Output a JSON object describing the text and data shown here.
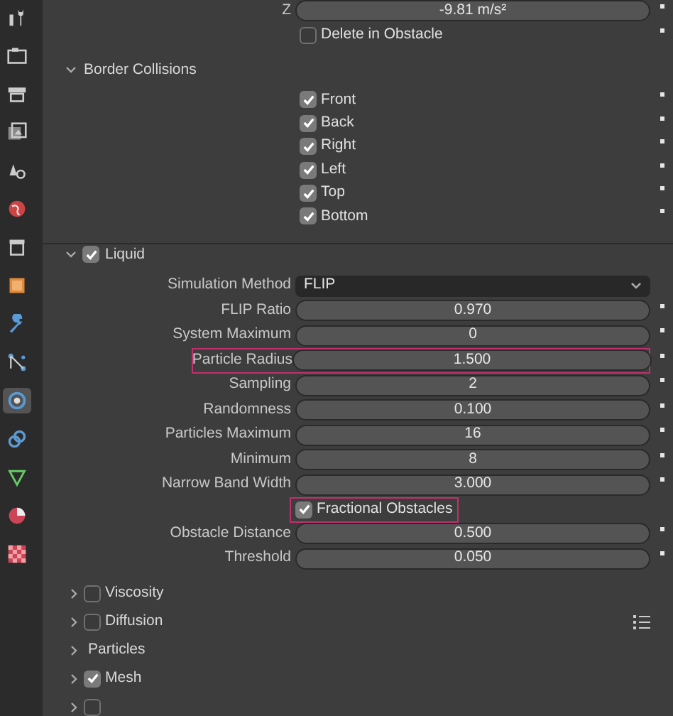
{
  "sidebar_tabs": [
    {
      "kind": "tool",
      "selected": false
    },
    {
      "kind": "render",
      "selected": false
    },
    {
      "kind": "output",
      "selected": false
    },
    {
      "kind": "view_layer",
      "selected": false
    },
    {
      "kind": "scene",
      "selected": false
    },
    {
      "kind": "world",
      "selected": false
    },
    {
      "kind": "collection",
      "selected": false
    },
    {
      "kind": "object",
      "selected": false
    },
    {
      "kind": "modifiers",
      "selected": false
    },
    {
      "kind": "particles",
      "selected": false
    },
    {
      "kind": "physics",
      "selected": true
    },
    {
      "kind": "constraints",
      "selected": false
    },
    {
      "kind": "data",
      "selected": false
    },
    {
      "kind": "material",
      "selected": false
    },
    {
      "kind": "texture",
      "selected": false
    }
  ],
  "top_rows": [
    {
      "kind": "field",
      "label": "Z",
      "value": "-9.81 m/s²",
      "keyframe_dot": true,
      "highlighted": false
    },
    {
      "kind": "checkbox",
      "label": "Delete in Obstacle",
      "checked": false,
      "keyframe_dot": true,
      "highlighted": false
    }
  ],
  "border_collisions": {
    "title": "Border Collisions",
    "expanded": true,
    "rows": [
      {
        "kind": "checkbox",
        "label": "Front",
        "checked": true,
        "keyframe_dot": true,
        "highlighted": false
      },
      {
        "kind": "checkbox",
        "label": "Back",
        "checked": true,
        "keyframe_dot": true,
        "highlighted": false
      },
      {
        "kind": "checkbox",
        "label": "Right",
        "checked": true,
        "keyframe_dot": true,
        "highlighted": false
      },
      {
        "kind": "checkbox",
        "label": "Left",
        "checked": true,
        "keyframe_dot": true,
        "highlighted": false
      },
      {
        "kind": "checkbox",
        "label": "Top",
        "checked": true,
        "keyframe_dot": true,
        "highlighted": false
      },
      {
        "kind": "checkbox",
        "label": "Bottom",
        "checked": true,
        "keyframe_dot": true,
        "highlighted": false
      }
    ]
  },
  "liquid": {
    "title": "Liquid",
    "checked": true,
    "expanded": true,
    "rows": [
      {
        "kind": "dropdown",
        "label": "Simulation Method",
        "value": "FLIP",
        "keyframe_dot": false,
        "highlighted": false
      },
      {
        "kind": "field",
        "label": "FLIP Ratio",
        "value": "0.970",
        "keyframe_dot": true,
        "highlighted": false
      },
      {
        "kind": "field",
        "label": "System Maximum",
        "value": "0",
        "keyframe_dot": true,
        "highlighted": false
      },
      {
        "kind": "field",
        "label": "Particle Radius",
        "value": "1.500",
        "keyframe_dot": true,
        "highlighted": true
      },
      {
        "kind": "field",
        "label": "Sampling",
        "value": "2",
        "keyframe_dot": true,
        "highlighted": false
      },
      {
        "kind": "field",
        "label": "Randomness",
        "value": "0.100",
        "keyframe_dot": true,
        "highlighted": false
      },
      {
        "kind": "field",
        "label": "Particles Maximum",
        "value": "16",
        "keyframe_dot": true,
        "highlighted": false
      },
      {
        "kind": "field",
        "label": "Minimum",
        "value": "8",
        "keyframe_dot": true,
        "highlighted": false
      },
      {
        "kind": "field",
        "label": "Narrow Band Width",
        "value": "3.000",
        "keyframe_dot": true,
        "highlighted": false
      },
      {
        "kind": "checkbox",
        "label": "Fractional Obstacles",
        "checked": true,
        "keyframe_dot": false,
        "highlighted": true
      },
      {
        "kind": "field",
        "label": "Obstacle Distance",
        "value": "0.500",
        "keyframe_dot": true,
        "highlighted": false
      },
      {
        "kind": "field",
        "label": "Threshold",
        "value": "0.050",
        "keyframe_dot": true,
        "highlighted": false
      }
    ]
  },
  "subpanels": [
    {
      "title": "Viscosity",
      "kind": "checkbox",
      "checked": false,
      "expanded": false,
      "grip": false
    },
    {
      "title": "Diffusion",
      "kind": "checkbox",
      "checked": false,
      "expanded": false,
      "grip": true
    },
    {
      "title": "Particles",
      "kind": "plain",
      "expanded": false,
      "grip": false
    },
    {
      "title": "Mesh",
      "kind": "checkbox",
      "checked": true,
      "expanded": false,
      "grip": false
    },
    {
      "kind": "checkbox",
      "checked": false,
      "expanded": false,
      "grip": false
    }
  ]
}
